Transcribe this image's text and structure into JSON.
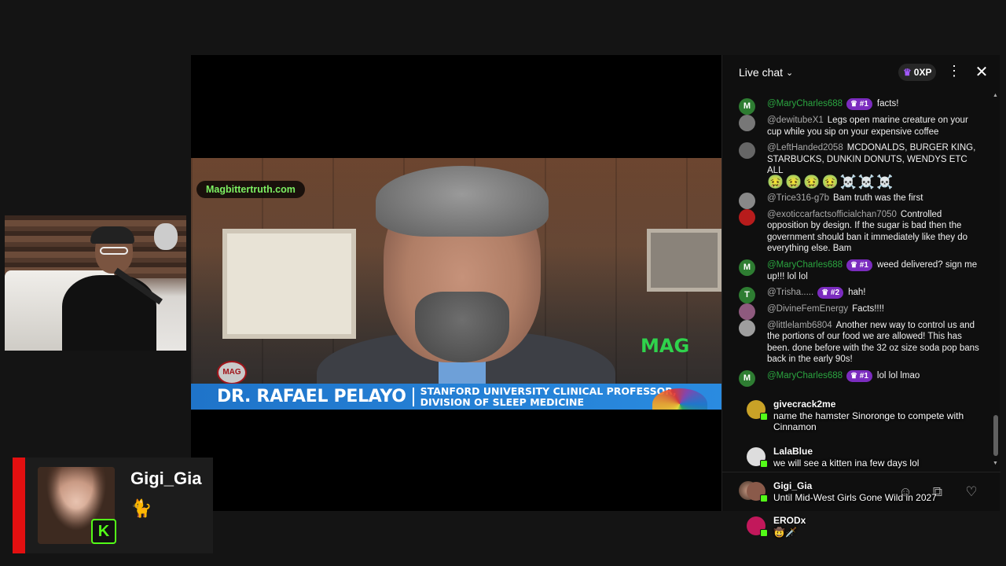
{
  "video": {
    "site_tag": "Magbittertruth.com",
    "mag_logo": "MAG",
    "mag_badge": "MAG",
    "lower_third_name": "DR. RAFAEL PELAYO",
    "lower_third_title_line1": "STANFORD UNIVERSITY CLINICAL PROFESSOR,",
    "lower_third_title_line2": "DIVISION OF SLEEP MEDICINE"
  },
  "streamer": {
    "name": "Gigi_Gia",
    "kick_letter": "K",
    "accent_color": "#e30f10"
  },
  "chat": {
    "title": "Live chat",
    "xp_label": "0XP",
    "input_placeholder": "",
    "messages": [
      {
        "avatar": "M",
        "avatar_color": "#2e7d32",
        "author": "@MaryCharles688",
        "member": true,
        "rank": "#1",
        "text": "facts!"
      },
      {
        "avatar": "",
        "avatar_color": "#777",
        "author": "@dewitubeX1",
        "member": false,
        "rank": "",
        "text": "Legs open marine creature on your cup while you sip on your expensive coffee"
      },
      {
        "avatar": "",
        "avatar_color": "#666",
        "author": "@LeftHanded2058",
        "member": false,
        "rank": "",
        "text": "MCDONALDS, BURGER KING, STARBUCKS, DUNKIN DONUTS, WENDYS ETC ALL",
        "emoji": "🤢🤢🤢🤢☠️☠️☠️"
      },
      {
        "avatar": "",
        "avatar_color": "#888",
        "author": "@Trice316-g7b",
        "member": false,
        "rank": "",
        "text": "Bam truth was the first"
      },
      {
        "avatar": "",
        "avatar_color": "#b71c1c",
        "author": "@exoticcarfactsofficialchan7050",
        "member": false,
        "rank": "",
        "text": "Controlled opposition by design. If the sugar is bad then the government should ban it immediately like they do everything else. Bam"
      },
      {
        "avatar": "M",
        "avatar_color": "#2e7d32",
        "author": "@MaryCharles688",
        "member": true,
        "rank": "#1",
        "text": "weed delivered? sign me up!!! lol lol"
      },
      {
        "avatar": "T",
        "avatar_color": "#2e7d32",
        "author": "@Trisha.....",
        "member": false,
        "rank": "#2",
        "text": "hah!"
      },
      {
        "avatar": "",
        "avatar_color": "#8e5a7e",
        "author": "@DivineFemEnergy",
        "member": false,
        "rank": "",
        "text": "Facts!!!!"
      },
      {
        "avatar": "",
        "avatar_color": "#9e9e9e",
        "author": "@littlelamb6804",
        "member": false,
        "rank": "",
        "text": "Another new way to control us and the portions of our food we are allowed! This has been. done before with the 32 oz size soda pop bans back in the early 90s!"
      },
      {
        "avatar": "M",
        "avatar_color": "#2e7d32",
        "author": "@MaryCharles688",
        "member": true,
        "rank": "#1",
        "text": "lol lol lmao"
      }
    ]
  },
  "overlay": {
    "messages": [
      {
        "name": "givecrack2me",
        "text": "name the hamster Sinoronge to compete with Cinnamon",
        "avatar_color": "#c9a227"
      },
      {
        "name": "LalaBlue",
        "text": "we will see a kitten ina few days lol",
        "avatar_color": "#ddd"
      },
      {
        "name": "Gigi_Gia",
        "text": "Until Mid-West Girls Gone Wild in 2027",
        "avatar_color": "#8a5a4a"
      },
      {
        "name": "ERODx",
        "text": "🤠🗡️",
        "avatar_color": "#c2185b"
      }
    ]
  },
  "icons": {
    "chevron": "chevron-down-icon",
    "crown": "crown-icon",
    "more": "more-vert-icon",
    "close": "close-icon",
    "emoji": "emoji-icon",
    "gift": "gift-icon",
    "heart": "heart-icon"
  }
}
